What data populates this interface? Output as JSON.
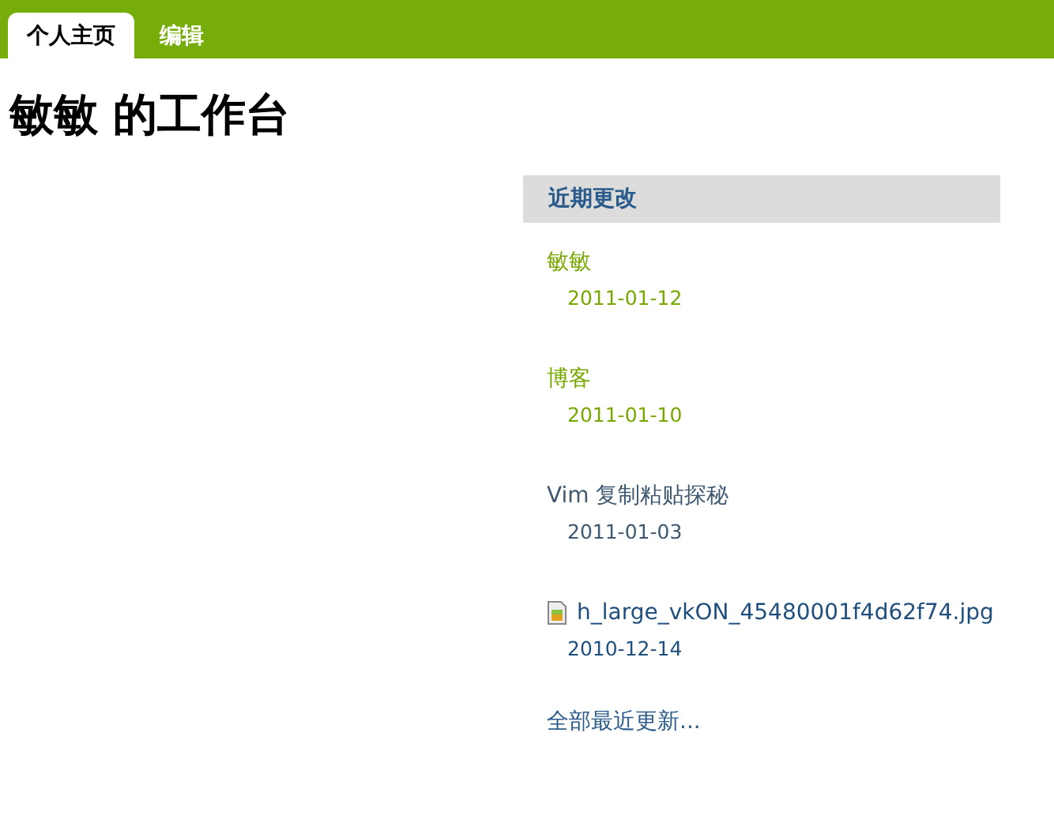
{
  "tabs": [
    {
      "label": "个人主页",
      "selected": true
    },
    {
      "label": "编辑",
      "selected": false
    }
  ],
  "heading": "敏敏 的工作台",
  "recent": {
    "title": "近期更改",
    "items": [
      {
        "kind": "page",
        "title": "敏敏",
        "date": "2011-01-12",
        "color": "#76a800"
      },
      {
        "kind": "page",
        "title": "博客",
        "date": "2011-01-10",
        "color": "#76a800"
      },
      {
        "kind": "page",
        "title": "Vim 复制粘贴探秘",
        "date": "2011-01-03",
        "color": "#3d5870"
      },
      {
        "kind": "file",
        "title": "h_large_vkON_45480001f4d62f74.jpg",
        "date": "2010-12-14",
        "color": "#1f4f7f"
      }
    ],
    "more": "全部最近更新..."
  }
}
